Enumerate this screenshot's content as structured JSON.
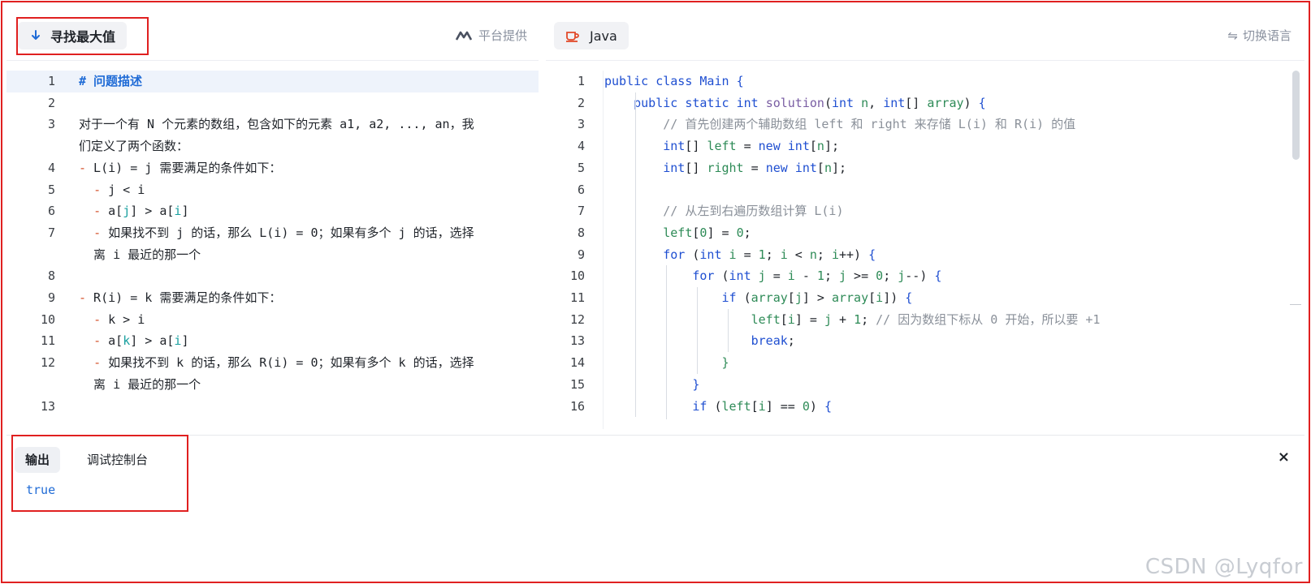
{
  "left_pane": {
    "title": "寻找最大值",
    "provider_label": "平台提供",
    "lines": [
      {
        "n": "1",
        "html": "<span class=\"md-h\"># 问题描述</span>"
      },
      {
        "n": "2",
        "html": ""
      },
      {
        "n": "3",
        "html": "对于一个有 N 个元素的数组，包含如下的元素 a1, a2, ..., an，我"
      },
      {
        "n": "",
        "html": "们定义了两个函数："
      },
      {
        "n": "4",
        "html": "<span class=\"md-dash\">-</span> L(i) = j 需要满足的条件如下："
      },
      {
        "n": "5",
        "html": "  <span class=\"md-dash\">-</span> j &lt; i"
      },
      {
        "n": "6",
        "html": "  <span class=\"md-dash\">-</span> a[<span class=\"md-cyan\">j</span>] &gt; a[<span class=\"md-cyan\">i</span>]"
      },
      {
        "n": "7",
        "html": "  <span class=\"md-dash\">-</span> 如果找不到 j 的话，那么 L(i) = 0；如果有多个 j 的话，选择"
      },
      {
        "n": "",
        "html": "  离 i 最近的那一个"
      },
      {
        "n": "8",
        "html": ""
      },
      {
        "n": "9",
        "html": "<span class=\"md-dash\">-</span> R(i) = k 需要满足的条件如下："
      },
      {
        "n": "10",
        "html": "  <span class=\"md-dash\">-</span> k &gt; i"
      },
      {
        "n": "11",
        "html": "  <span class=\"md-dash\">-</span> a[<span class=\"md-cyan\">k</span>] &gt; a[<span class=\"md-cyan\">i</span>]"
      },
      {
        "n": "12",
        "html": "  <span class=\"md-dash\">-</span> 如果找不到 k 的话，那么 R(i) = 0；如果有多个 k 的话，选择"
      },
      {
        "n": "",
        "html": "  离 i 最近的那一个"
      },
      {
        "n": "13",
        "html": ""
      }
    ]
  },
  "right_pane": {
    "language": "Java",
    "switch_label": "切换语言",
    "lines": [
      {
        "n": "1",
        "html": "<span class=\"kw\">public</span> <span class=\"kw\">class</span> <span class=\"ty\">Main</span> <span class=\"bl\">{</span>"
      },
      {
        "n": "2",
        "html": "    <span class=\"kw\">public</span> <span class=\"kw\">static</span> <span class=\"ty\">int</span> <span class=\"fn\">solution</span>(<span class=\"ty\">int</span> <span class=\"pm\">n</span>, <span class=\"ty\">int</span>[] <span class=\"pm\">array</span>) <span class=\"bl\">{</span>"
      },
      {
        "n": "3",
        "html": "        <span class=\"cm\">// 首先创建两个辅助数组 left 和 right 来存储 L(i) 和 R(i) 的值</span>"
      },
      {
        "n": "4",
        "html": "        <span class=\"ty\">int</span>[] <span class=\"var\">left</span> = <span class=\"kw\">new</span> <span class=\"ty\">int</span>[<span class=\"pm\">n</span>];"
      },
      {
        "n": "5",
        "html": "        <span class=\"ty\">int</span>[] <span class=\"var\">right</span> = <span class=\"kw\">new</span> <span class=\"ty\">int</span>[<span class=\"pm\">n</span>];"
      },
      {
        "n": "6",
        "html": ""
      },
      {
        "n": "7",
        "html": "        <span class=\"cm\">// 从左到右遍历数组计算 L(i)</span>"
      },
      {
        "n": "8",
        "html": "        <span class=\"var\">left</span>[<span class=\"nm\">0</span>] = <span class=\"nm\">0</span>;"
      },
      {
        "n": "9",
        "html": "        <span class=\"kw\">for</span> (<span class=\"ty\">int</span> <span class=\"var\">i</span> = <span class=\"nm\">1</span>; <span class=\"var\">i</span> &lt; <span class=\"pm\">n</span>; <span class=\"var\">i</span>++) <span class=\"bl\">{</span>"
      },
      {
        "n": "10",
        "html": "            <span class=\"kw\">for</span> (<span class=\"ty\">int</span> <span class=\"var\">j</span> = <span class=\"var\">i</span> - <span class=\"nm\">1</span>; <span class=\"var\">j</span> &gt;= <span class=\"nm\">0</span>; <span class=\"var\">j</span>--) <span class=\"bl\">{</span>"
      },
      {
        "n": "11",
        "html": "                <span class=\"kw\">if</span> (<span class=\"pm\">array</span>[<span class=\"var\">j</span>] &gt; <span class=\"pm\">array</span>[<span class=\"var\">i</span>]) <span class=\"bl\">{</span>"
      },
      {
        "n": "12",
        "html": "                    <span class=\"var\">left</span>[<span class=\"var\">i</span>] = <span class=\"var\">j</span> + <span class=\"nm\">1</span>; <span class=\"cm\">// 因为数组下标从 0 开始，所以要 +1</span>"
      },
      {
        "n": "13",
        "html": "                    <span class=\"kw\">break</span>;"
      },
      {
        "n": "14",
        "html": "                <span class=\"pm\">}</span>"
      },
      {
        "n": "15",
        "html": "            <span class=\"bl\">}</span>"
      },
      {
        "n": "16",
        "html": "            <span class=\"kw\">if</span> (<span class=\"var\">left</span>[<span class=\"var\">i</span>] == <span class=\"nm\">0</span>) <span class=\"bl\">{</span>"
      }
    ]
  },
  "bottom_panel": {
    "tab_output": "输出",
    "tab_console": "调试控制台",
    "output_text": "true",
    "close_symbol": "×"
  },
  "watermark": "CSDN @Lyqfor"
}
